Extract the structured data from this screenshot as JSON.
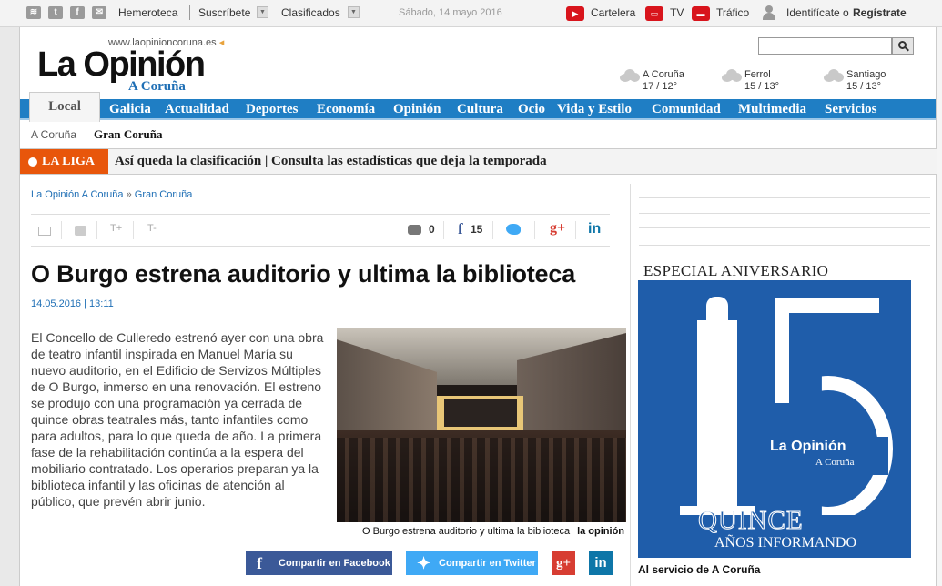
{
  "topbar": {
    "hemeroteca": "Hemeroteca",
    "suscribete": "Suscríbete",
    "clasificados": "Clasificados",
    "date": "Sábado, 14 mayo 2016",
    "cartelera": "Cartelera",
    "tv": "TV",
    "trafico": "Tráfico",
    "identificate": "Identifícate o",
    "registrate": "Regístrate"
  },
  "header": {
    "url": "www.laopinioncoruna.es",
    "logo": "La Opinión",
    "logo_sub": "A Coruña"
  },
  "weather": [
    {
      "city": "A Coruña",
      "temp": "17 / 12°"
    },
    {
      "city": "Ferrol",
      "temp": "15 / 13°"
    },
    {
      "city": "Santiago",
      "temp": "15 / 13°"
    }
  ],
  "nav": {
    "active": "Local",
    "items": [
      "Galicia",
      "Actualidad",
      "Deportes",
      "Economía",
      "Opinión",
      "Cultura",
      "Ocio",
      "Vida y Estilo",
      "Comunidad",
      "Multimedia",
      "Servicios"
    ]
  },
  "subnav": {
    "a": "A Coruña",
    "b": "Gran Coruña"
  },
  "liga": {
    "tag": "LA LIGA",
    "text": "Así queda la clasificación  |  Consulta las estadísticas que deja la temporada"
  },
  "breadcrumb": {
    "root": "La Opinión A Coruña",
    "sep": "»",
    "current": "Gran Coruña"
  },
  "toolbar": {
    "font_up": "T+",
    "font_down": "T-",
    "comments": "0",
    "facebook_count": "15"
  },
  "article": {
    "title": "O Burgo estrena auditorio y ultima la biblioteca",
    "date": "14.05.2016 | 13:11",
    "body": "El Concello de Culleredo estrenó ayer con una obra de teatro infantil inspirada en Manuel María su nuevo auditorio, en el Edificio de Servizos Múltiples de O Burgo, inmerso en una renovación. El estreno se produjo con una programación ya cerrada de quince obras teatrales más, tanto infantiles como para adultos, para lo que queda de año. La primera fase de la rehabilitación continúa a la espera del mobiliario contratado. Los operarios preparan ya la biblioteca infantil y las oficinas de atención al público, que prevén abrir junio.",
    "caption": "O Burgo estrena auditorio y ultima la biblioteca",
    "caption_credit": "la opinión"
  },
  "share": {
    "facebook": "Compartir en Facebook",
    "twitter": "Compartir en Twitter"
  },
  "sidebar": {
    "ad_title": "ESPECIAL ANIVERSARIO",
    "ad_logo": "La Opinión",
    "ad_logo_sub": "A Coruña",
    "ad_quince": "QUINCE",
    "ad_anos": "AÑOS INFORMANDO",
    "caption": "Al servicio de A Coruña"
  },
  "colors": {
    "nav_blue": "#1f7ec4",
    "liga_orange": "#e8560b",
    "brand_blue": "#1f6fb5",
    "ad_blue": "#1f5daa"
  }
}
